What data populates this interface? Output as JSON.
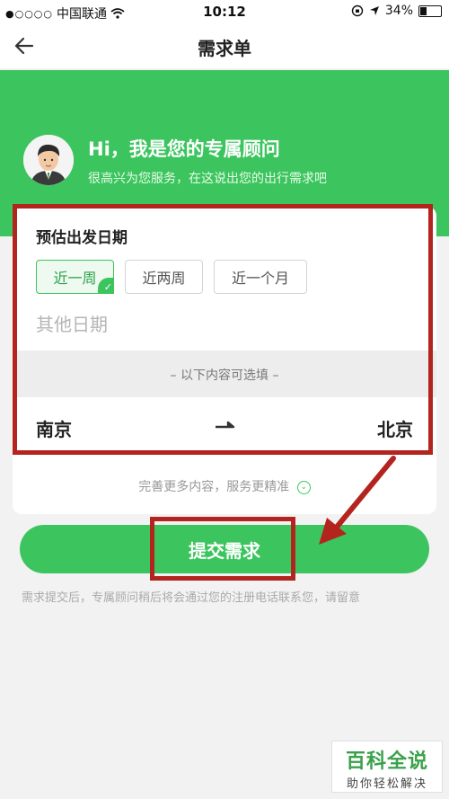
{
  "status_bar": {
    "carrier": "中国联通",
    "signal_dots": "●○○○○",
    "time": "10:12",
    "battery": "34%"
  },
  "nav": {
    "title": "需求单",
    "back_icon": "back-arrow-icon"
  },
  "greeting": {
    "title": "Hi，我是您的专属顾问",
    "subtitle": "很高兴为您服务，在这说出您的出行需求吧"
  },
  "date_section": {
    "title": "预估出发日期",
    "options": [
      "近一周",
      "近两周",
      "近一个月"
    ],
    "selected_option": "近一周",
    "other_placeholder": "其他日期"
  },
  "optional_label": "– 以下内容可选填 –",
  "route": {
    "from": "南京",
    "to": "北京"
  },
  "more_hint": "完善更多内容，服务更精准",
  "submit_label": "提交需求",
  "notice": "需求提交后，专属顾问稍后将会通过您的注册电话联系您，请留意",
  "watermark": {
    "main": "百科全说",
    "sub": "助你轻松解决"
  },
  "colors": {
    "brand_green": "#3cc55e",
    "annotation_red": "#b3241f"
  }
}
